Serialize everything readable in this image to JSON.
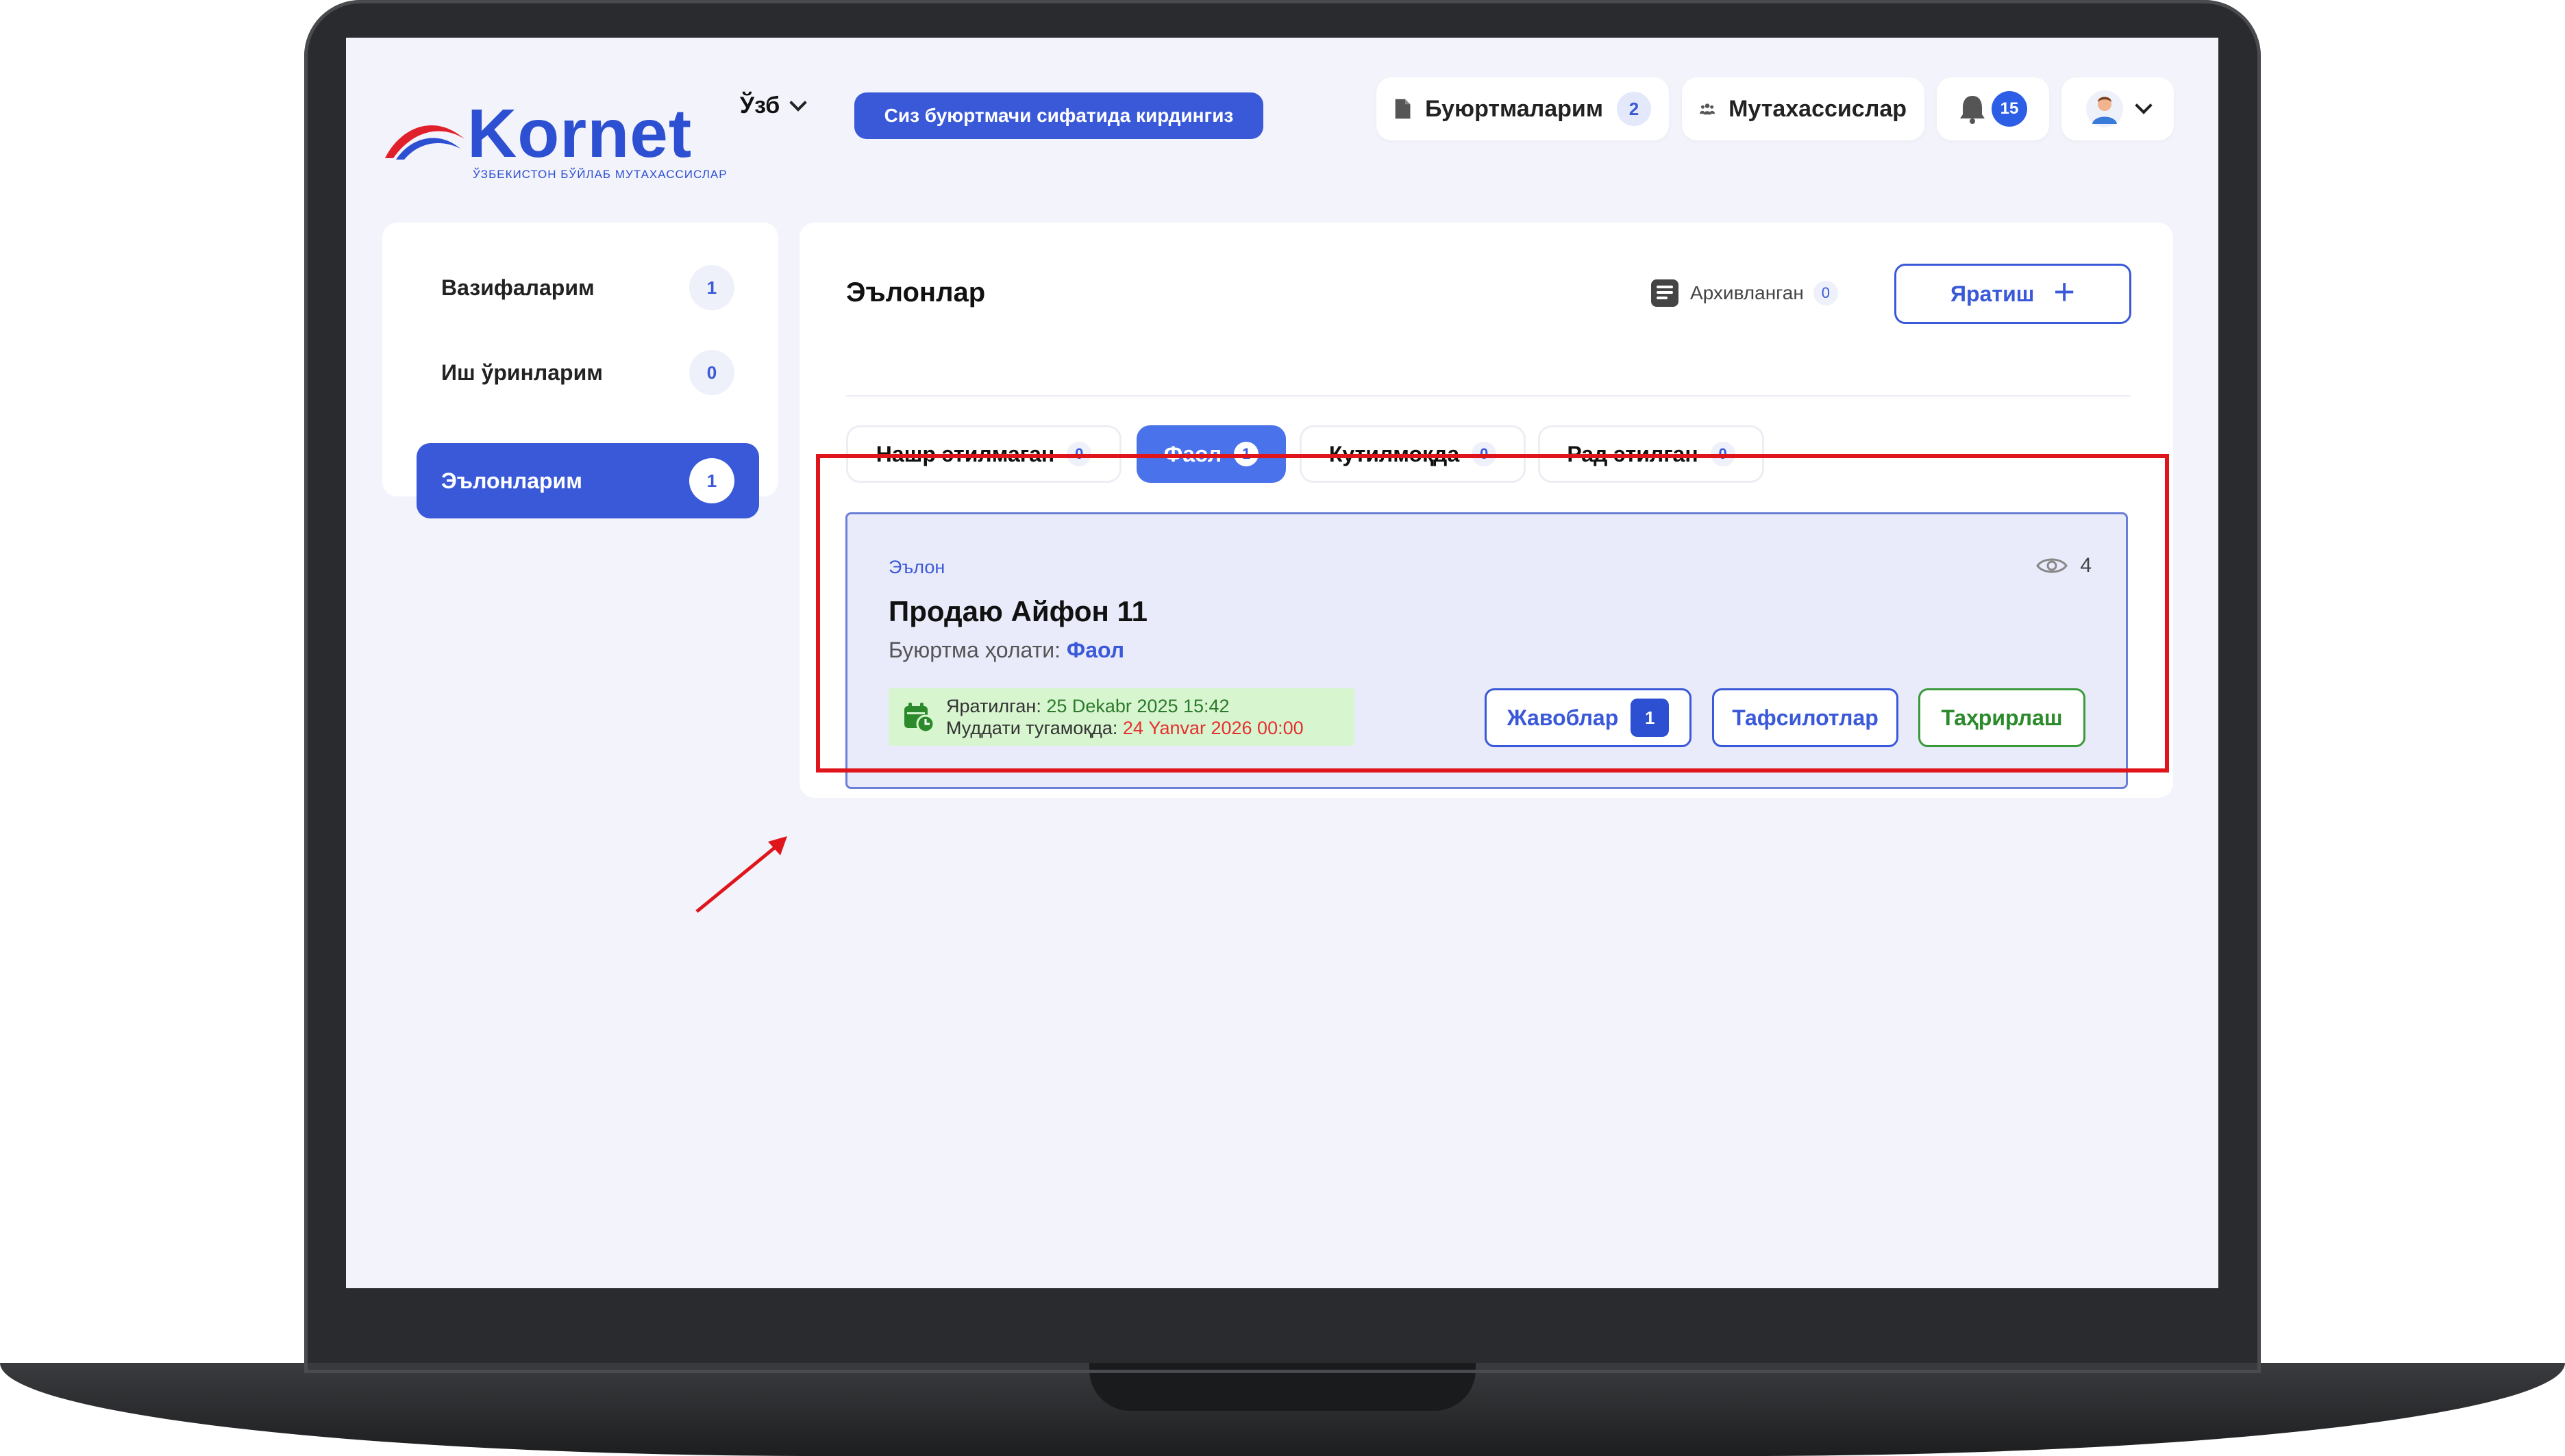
{
  "header": {
    "logo_text": "Kornet",
    "logo_subtitle": "ЎЗБЕКИСТОН БЎЙЛАБ МУТАХАССИСЛАР",
    "language": "Ўзб",
    "role_banner": "Сиз буюртмачи сифатида кирдингиз",
    "orders_label": "Буюртмаларим",
    "orders_count": "2",
    "specialists_label": "Мутахассислар",
    "notifications_count": "15",
    "icons": [
      "document-icon",
      "people-icon",
      "bell-icon",
      "avatar-icon",
      "chevron-down-icon"
    ]
  },
  "sidebar": {
    "items": [
      {
        "label": "Вазифаларим",
        "count": "1",
        "active": false
      },
      {
        "label": "Иш ўринларим",
        "count": "0",
        "active": false
      },
      {
        "label": "Эълонларим",
        "count": "1",
        "active": true
      }
    ]
  },
  "main": {
    "title": "Эълонлар",
    "archive_label": "Архивланган",
    "archive_count": "0",
    "create_label": "Яратиш",
    "tabs": [
      {
        "label": "Нашр этилмаган",
        "count": "0",
        "active": false
      },
      {
        "label": "Фаол",
        "count": "1",
        "active": true
      },
      {
        "label": "Кутилмоқда",
        "count": "0",
        "active": false
      },
      {
        "label": "Рад этилган",
        "count": "0",
        "active": false
      }
    ],
    "card": {
      "kicker": "Эълон",
      "views": "4",
      "title": "Продаю Айфон 11",
      "status_label": "Буюртма ҳолати:",
      "status_value": "Фаол",
      "created_label": "Яратилган:",
      "created_value": "25 Dekabr 2025 15:42",
      "deadline_label": "Муддати тугамоқда:",
      "deadline_value": "24 Yanvar 2026 00:00",
      "replies_label": "Жавоблар",
      "replies_count": "1",
      "details_label": "Тафсилотлар",
      "edit_label": "Таҳрирлаш"
    }
  },
  "colors": {
    "accent": "#3a59d8",
    "active_tab": "#4a72ea",
    "highlight": "#e0151b",
    "success": "#2b8a2b",
    "danger": "#e53030"
  }
}
